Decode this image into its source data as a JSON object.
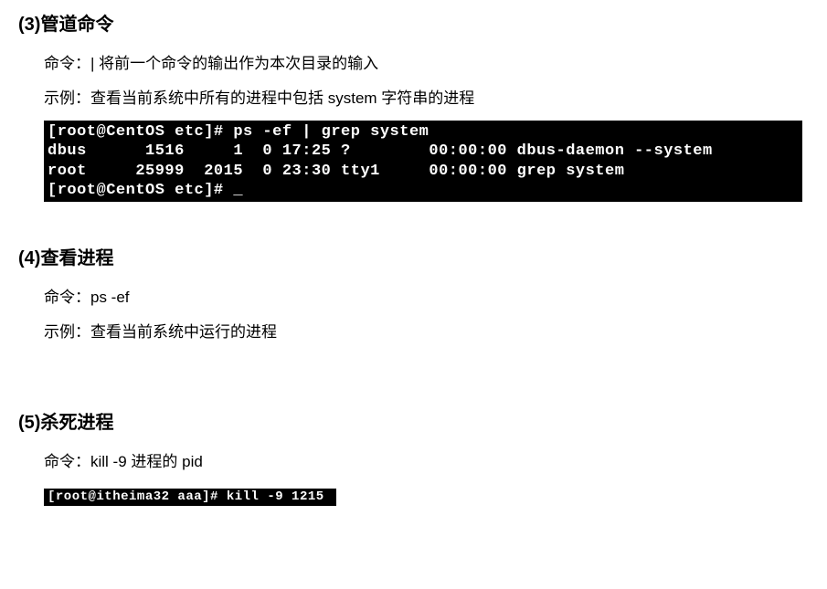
{
  "sections": [
    {
      "number": "(3)",
      "title": "管道命令",
      "cmd_label": "命令：|     将前一个命令的输出作为本次目录的输入",
      "example_label": "示例：查看当前系统中所有的进程中包括 system 字符串的进程",
      "terminal": "[root@CentOS etc]# ps -ef | grep system\ndbus      1516     1  0 17:25 ?        00:00:00 dbus-daemon --system\nroot     25999  2015  0 23:30 tty1     00:00:00 grep system\n[root@CentOS etc]# _"
    },
    {
      "number": "(4)",
      "title": "查看进程",
      "cmd_label": "命令：ps -ef",
      "example_label": "示例：查看当前系统中运行的进程",
      "terminal": ""
    },
    {
      "number": "(5)",
      "title": "杀死进程",
      "cmd_label": "命令：kill -9  进程的 pid",
      "example_label": "",
      "terminal": "[root@itheima32 aaa]# kill -9 1215 "
    }
  ]
}
